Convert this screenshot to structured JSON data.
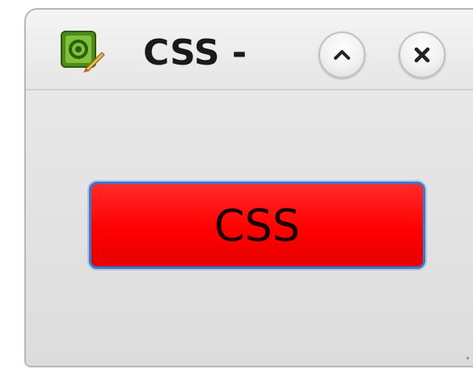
{
  "window": {
    "title": "CSS -",
    "app_icon": "image-editor-icon",
    "controls": {
      "minimize_icon": "chevron-up-icon",
      "close_icon": "close-icon"
    }
  },
  "main": {
    "button_label": "CSS",
    "button_color": "#ff0000",
    "button_border_color": "#3a78c8"
  }
}
